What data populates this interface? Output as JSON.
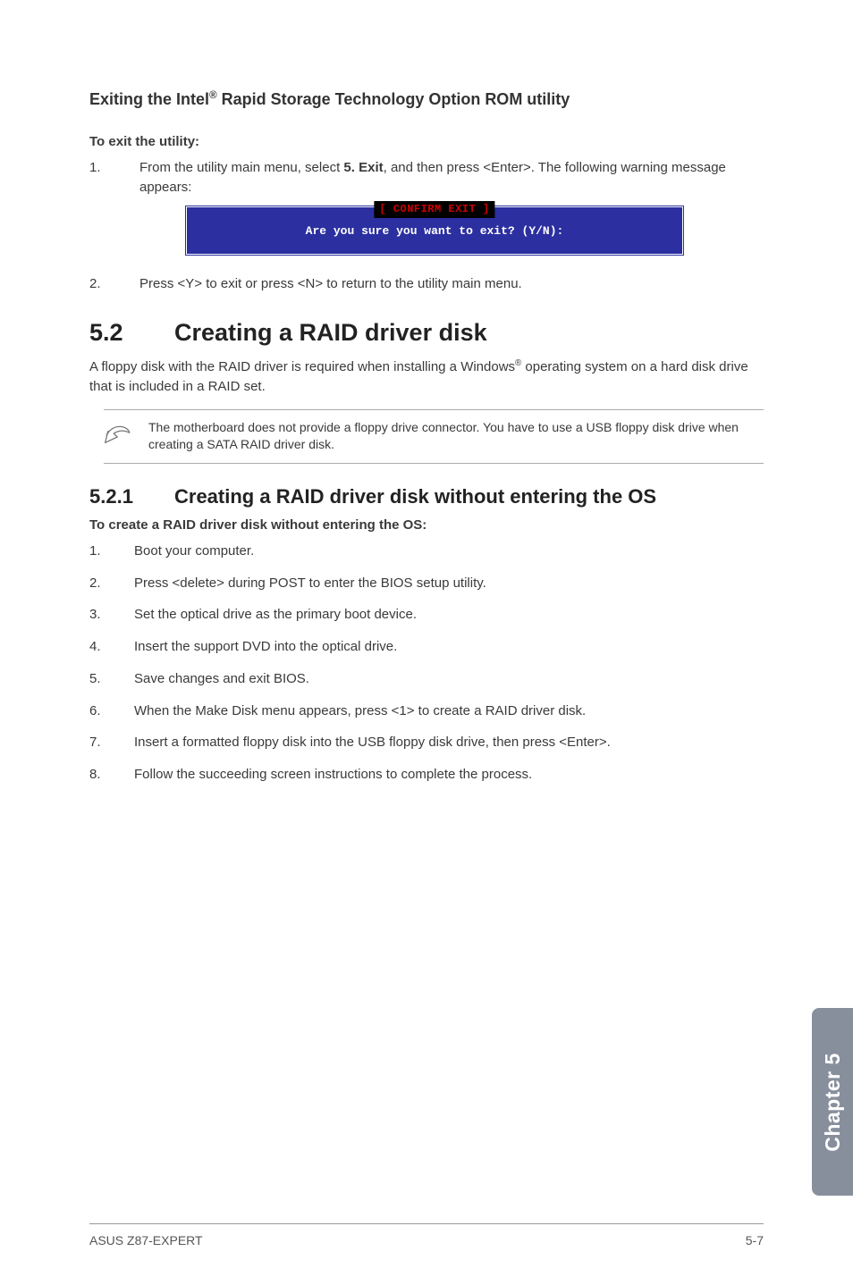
{
  "heading_exit": {
    "prefix": "Exiting the Intel",
    "reg": "®",
    "suffix": " Rapid Storage Technology Option ROM utility"
  },
  "exit_label": "To exit the utility:",
  "exit_steps": [
    {
      "pre": "From the utility main menu, select ",
      "bold": "5. Exit",
      "post": ", and then press <Enter>. The following warning message appears:"
    },
    {
      "pre": "Press <Y> to exit or press <N> to return to the utility main menu.",
      "bold": "",
      "post": ""
    }
  ],
  "dialog": {
    "title": "[ CONFIRM EXIT ]",
    "text": "Are you sure you want to exit? (Y/N):"
  },
  "sec52": {
    "num": "5.2",
    "title": "Creating a RAID driver disk"
  },
  "sec52_para": {
    "pre": "A floppy disk with the RAID driver is required when installing a Windows",
    "reg": "®",
    "post": " operating system on a hard disk drive that is included in a RAID set."
  },
  "note": "The motherboard does not provide a floppy drive connector. You have to use a USB floppy disk drive when creating a SATA RAID driver disk.",
  "sec521": {
    "num": "5.2.1",
    "title": "Creating a RAID driver disk without entering the OS"
  },
  "sec521_label": "To create a RAID driver disk without entering the OS:",
  "sec521_steps": [
    "Boot your computer.",
    "Press <delete> during POST to enter the BIOS setup utility.",
    "Set the optical drive as the primary boot device.",
    "Insert the support DVD into the optical drive.",
    "Save changes and exit BIOS.",
    "When the Make Disk menu appears, press <1> to create a RAID driver disk.",
    "Insert a formatted floppy disk into the USB floppy disk drive, then press <Enter>.",
    "Follow the succeeding screen instructions to complete the process."
  ],
  "side_tab": "Chapter 5",
  "footer": {
    "left": "ASUS Z87-EXPERT",
    "right": "5-7"
  }
}
